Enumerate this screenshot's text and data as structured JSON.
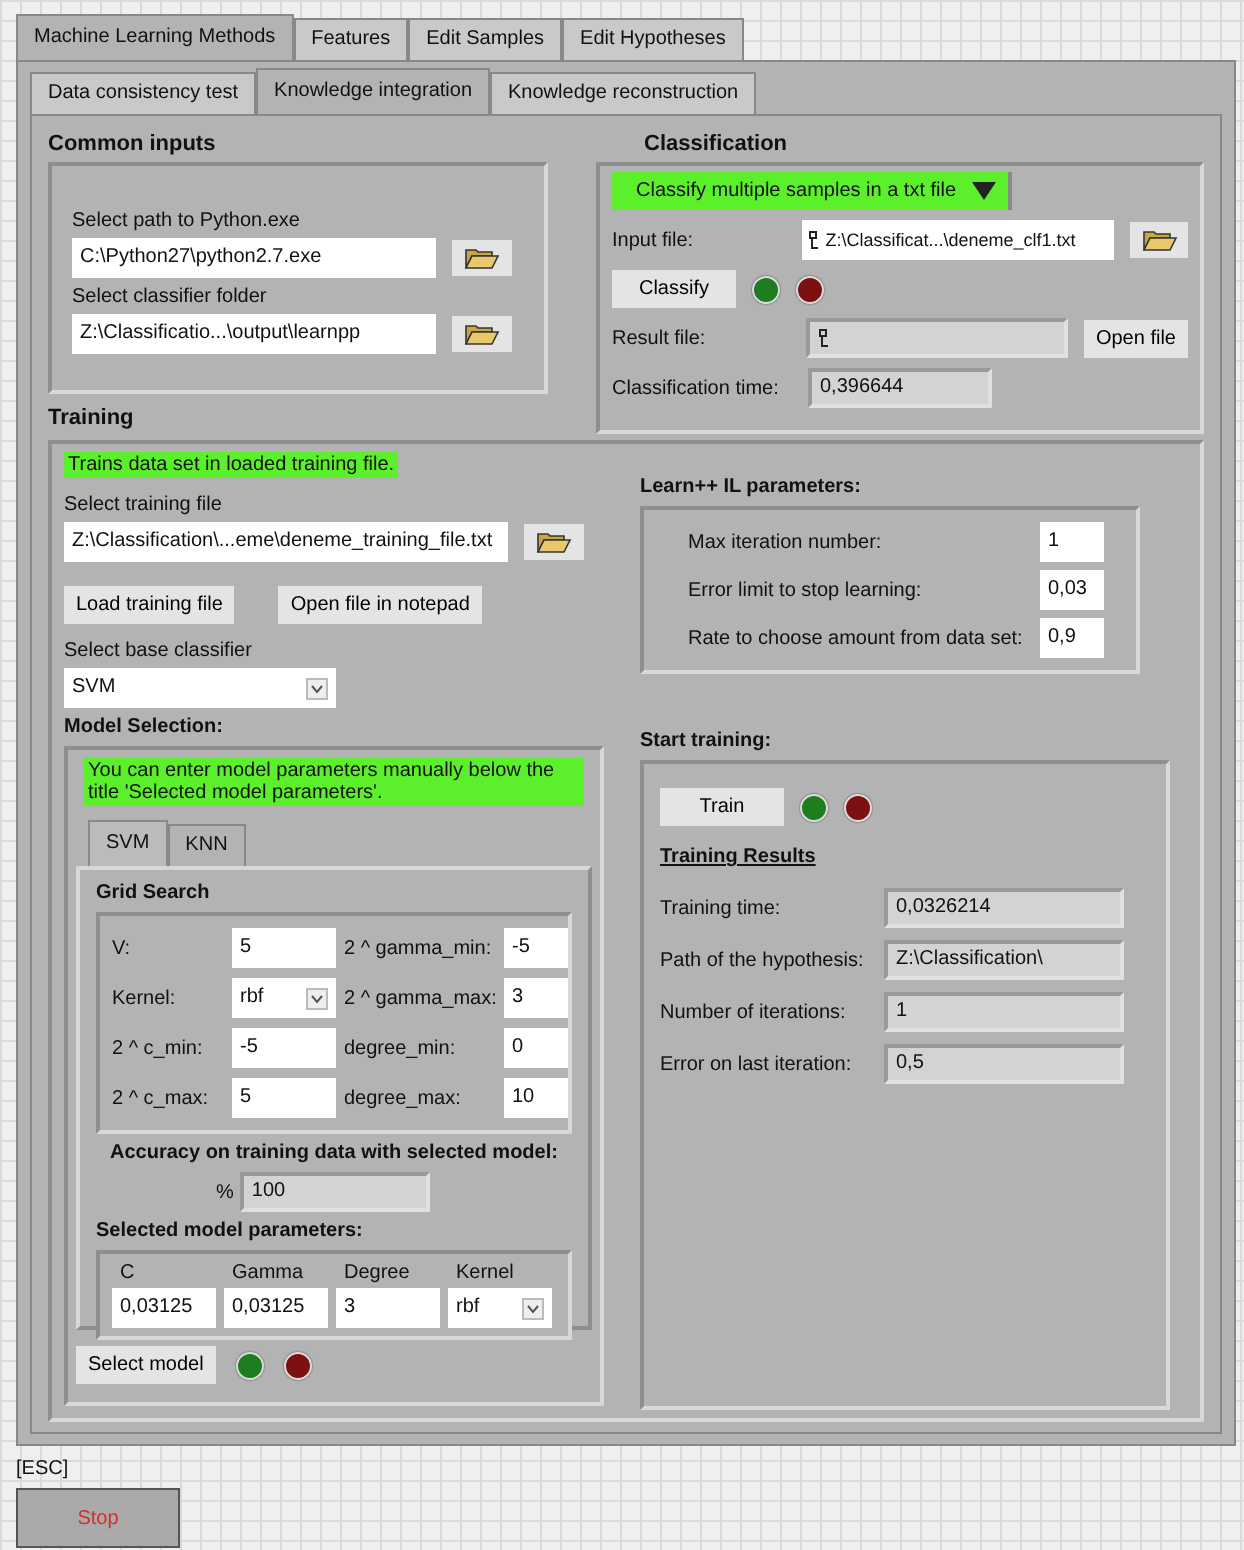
{
  "tabs": [
    {
      "label": "Machine Learning Methods",
      "selected": true
    },
    {
      "label": "Features",
      "selected": false
    },
    {
      "label": "Edit Samples",
      "selected": false
    },
    {
      "label": "Edit Hypotheses",
      "selected": false
    }
  ],
  "subtabs": [
    {
      "label": "Data consistency test",
      "selected": false
    },
    {
      "label": "Knowledge integration",
      "selected": true
    },
    {
      "label": "Knowledge reconstruction",
      "selected": false
    }
  ],
  "common_inputs": {
    "title": "Common inputs",
    "fields": [
      {
        "label": "Select path to Python.exe",
        "value": "C:\\Python27\\python2.7.exe"
      },
      {
        "label": "Select classifier folder",
        "value": "Z:\\Classificatio...\\output\\learnpp"
      }
    ]
  },
  "classification": {
    "title": "Classification",
    "mode": "Classify multiple samples in a txt file",
    "input_label": "Input file:",
    "input_value": "Z:\\Classificat...\\deneme_clf1.txt",
    "button": "Classify",
    "leds": [
      {
        "color": "#1e7d1e"
      },
      {
        "color": "#7d1010"
      }
    ],
    "result_label": "Result file:",
    "open_button": "Open file",
    "time_label": "Classification time:",
    "time_value": "0,396644"
  },
  "training": {
    "title": "Training",
    "hint": "Trains data set in loaded training file.",
    "file_label": "Select training file",
    "file_value": "Z:\\Classification\\...eme\\deneme_training_file.txt",
    "buttons": [
      "Load training file",
      "Open file in notepad"
    ],
    "classifier_label": "Select base classifier",
    "classifier_value": "SVM",
    "model_selection": {
      "title": "Model Selection:",
      "hint": "You can enter model parameters manually below the title 'Selected model parameters'.",
      "tabs": [
        {
          "label": "SVM",
          "selected": true
        },
        {
          "label": "KNN",
          "selected": false
        }
      ],
      "grid_title": "Grid Search",
      "grid": [
        {
          "label": "V:",
          "value": "5",
          "kind": "number"
        },
        {
          "label": "2 ^ gamma_min:",
          "value": "-5",
          "kind": "number"
        },
        {
          "label": "Kernel:",
          "value": "rbf",
          "kind": "select"
        },
        {
          "label": "2 ^ gamma_max:",
          "value": "3",
          "kind": "number"
        },
        {
          "label": "2 ^ c_min:",
          "value": "-5",
          "kind": "number"
        },
        {
          "label": "degree_min:",
          "value": "0",
          "kind": "number"
        },
        {
          "label": "2 ^ c_max:",
          "value": "5",
          "kind": "number"
        },
        {
          "label": "degree_max:",
          "value": "10",
          "kind": "number"
        }
      ],
      "accuracy_title": "Accuracy on training data with selected model:",
      "accuracy_unit": "%",
      "accuracy_value": "100",
      "selected_title": "Selected model parameters:",
      "params": [
        {
          "label": "C",
          "value": "0,03125",
          "kind": "number"
        },
        {
          "label": "Gamma",
          "value": "0,03125",
          "kind": "number"
        },
        {
          "label": "Degree",
          "value": "3",
          "kind": "number"
        },
        {
          "label": "Kernel",
          "value": "rbf",
          "kind": "select"
        }
      ],
      "select_button": "Select model",
      "leds": [
        {
          "color": "#1e7d1e"
        },
        {
          "color": "#7d1010"
        }
      ]
    },
    "learn_params": {
      "title": "Learn++ IL parameters:",
      "rows": [
        {
          "label": "Max iteration number:",
          "value": "1"
        },
        {
          "label": "Error limit to stop learning:",
          "value": "0,03"
        },
        {
          "label": "Rate to choose amount from data set:",
          "value": "0,9"
        }
      ]
    },
    "start": {
      "title": "Start training:",
      "button": "Train",
      "leds": [
        {
          "color": "#1e7d1e"
        },
        {
          "color": "#7d1010"
        }
      ],
      "results_title": "Training Results",
      "results": [
        {
          "label": "Training time:",
          "value": "0,0326214"
        },
        {
          "label": "Path of the hypothesis:",
          "value": "Z:\\Classification\\"
        },
        {
          "label": "Number of iterations:",
          "value": "1"
        },
        {
          "label": "Error on last iteration:",
          "value": "0,5"
        }
      ]
    }
  },
  "esc_label": "[ESC]",
  "stop_button": "Stop"
}
